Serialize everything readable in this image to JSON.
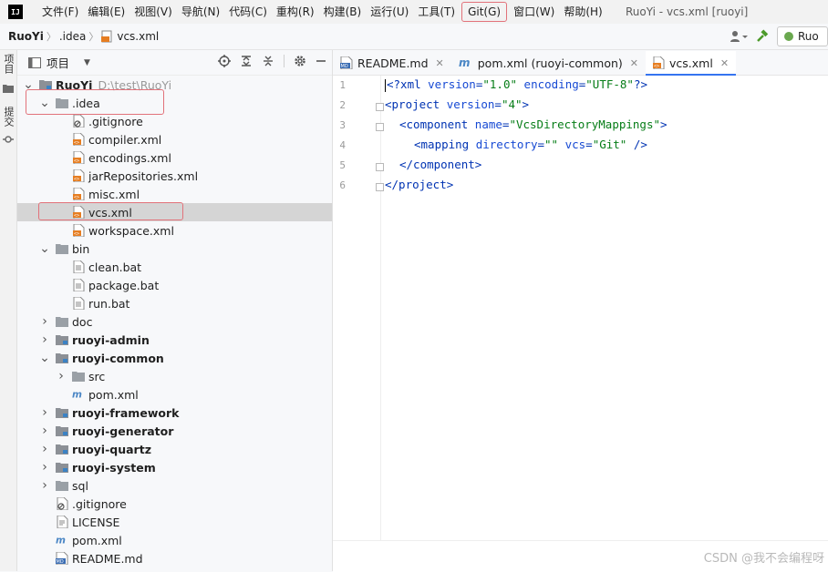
{
  "menu": [
    "文件(F)",
    "编辑(E)",
    "视图(V)",
    "导航(N)",
    "代码(C)",
    "重构(R)",
    "构建(B)",
    "运行(U)",
    "工具(T)",
    "Git(G)",
    "窗口(W)",
    "帮助(H)"
  ],
  "logo_text": "IJ",
  "window_title": "RuoYi - vcs.xml [ruoyi]",
  "breadcrumb": {
    "project": "RuoYi",
    "folder": ".idea",
    "file": "vcs.xml"
  },
  "run_config_label": "Ruo",
  "tool_strip": {
    "project_tab": "项目",
    "commit_tab": "提交"
  },
  "panel": {
    "title": "项目"
  },
  "tree": [
    {
      "label": "RuoYi",
      "hint": "D:\\test\\RuoYi",
      "indent": 0,
      "arrow": "expanded",
      "icon": "module-folder",
      "bold": true
    },
    {
      "label": ".idea",
      "indent": 1,
      "arrow": "expanded",
      "icon": "folder"
    },
    {
      "label": ".gitignore",
      "indent": 2,
      "icon": "ignore-file"
    },
    {
      "label": "compiler.xml",
      "indent": 2,
      "icon": "xml-file"
    },
    {
      "label": "encodings.xml",
      "indent": 2,
      "icon": "xml-file"
    },
    {
      "label": "jarRepositories.xml",
      "indent": 2,
      "icon": "xml-file"
    },
    {
      "label": "misc.xml",
      "indent": 2,
      "icon": "xml-file"
    },
    {
      "label": "vcs.xml",
      "indent": 2,
      "icon": "xml-file",
      "selected": true
    },
    {
      "label": "workspace.xml",
      "indent": 2,
      "icon": "xml-file"
    },
    {
      "label": "bin",
      "indent": 1,
      "arrow": "expanded",
      "icon": "folder"
    },
    {
      "label": "clean.bat",
      "indent": 2,
      "icon": "bat-file"
    },
    {
      "label": "package.bat",
      "indent": 2,
      "icon": "bat-file"
    },
    {
      "label": "run.bat",
      "indent": 2,
      "icon": "bat-file"
    },
    {
      "label": "doc",
      "indent": 1,
      "arrow": "collapsed",
      "icon": "folder"
    },
    {
      "label": "ruoyi-admin",
      "indent": 1,
      "arrow": "collapsed",
      "icon": "module-folder",
      "bold": true
    },
    {
      "label": "ruoyi-common",
      "indent": 1,
      "arrow": "expanded",
      "icon": "module-folder",
      "bold": true
    },
    {
      "label": "src",
      "indent": 2,
      "arrow": "collapsed",
      "icon": "folder"
    },
    {
      "label": "pom.xml",
      "indent": 2,
      "icon": "maven-file"
    },
    {
      "label": "ruoyi-framework",
      "indent": 1,
      "arrow": "collapsed",
      "icon": "module-folder",
      "bold": true
    },
    {
      "label": "ruoyi-generator",
      "indent": 1,
      "arrow": "collapsed",
      "icon": "module-folder",
      "bold": true
    },
    {
      "label": "ruoyi-quartz",
      "indent": 1,
      "arrow": "collapsed",
      "icon": "module-folder",
      "bold": true
    },
    {
      "label": "ruoyi-system",
      "indent": 1,
      "arrow": "collapsed",
      "icon": "module-folder",
      "bold": true
    },
    {
      "label": "sql",
      "indent": 1,
      "arrow": "collapsed",
      "icon": "folder"
    },
    {
      "label": ".gitignore",
      "indent": 1,
      "icon": "ignore-file"
    },
    {
      "label": "LICENSE",
      "indent": 1,
      "icon": "text-file"
    },
    {
      "label": "pom.xml",
      "indent": 1,
      "icon": "maven-file"
    },
    {
      "label": "README.md",
      "indent": 1,
      "icon": "md-file"
    }
  ],
  "tabs": [
    {
      "label": "README.md",
      "icon": "md-file",
      "active": false
    },
    {
      "label": "pom.xml (ruoyi-common)",
      "icon": "maven-file",
      "active": false
    },
    {
      "label": "vcs.xml",
      "icon": "xml-file",
      "active": true
    }
  ],
  "code_lines": [
    "1",
    "2",
    "3",
    "4",
    "5",
    "6"
  ],
  "code": {
    "l1": {
      "a": "<?xml ",
      "b": "version",
      "c": "=",
      "d": "\"1.0\"",
      "e": " encoding",
      "f": "=",
      "g": "\"UTF-8\"",
      "h": "?>"
    },
    "l2": {
      "a": "<project ",
      "b": "version",
      "c": "=",
      "d": "\"4\"",
      "e": ">"
    },
    "l3": {
      "a": "<component ",
      "b": "name",
      "c": "=",
      "d": "\"VcsDirectoryMappings\"",
      "e": ">"
    },
    "l4": {
      "a": "<mapping ",
      "b": "directory",
      "c": "=",
      "d": "\"\"",
      "e": " vcs",
      "f": "=",
      "g": "\"Git\"",
      "h": " />"
    },
    "l5": {
      "a": "</component>"
    },
    "l6": {
      "a": "</project>"
    }
  },
  "watermark": "CSDN @我不会编程呀",
  "colors": {
    "highlight_box": "#e2727a",
    "accent": "#3574f0",
    "selection": "#d5d5d5"
  }
}
